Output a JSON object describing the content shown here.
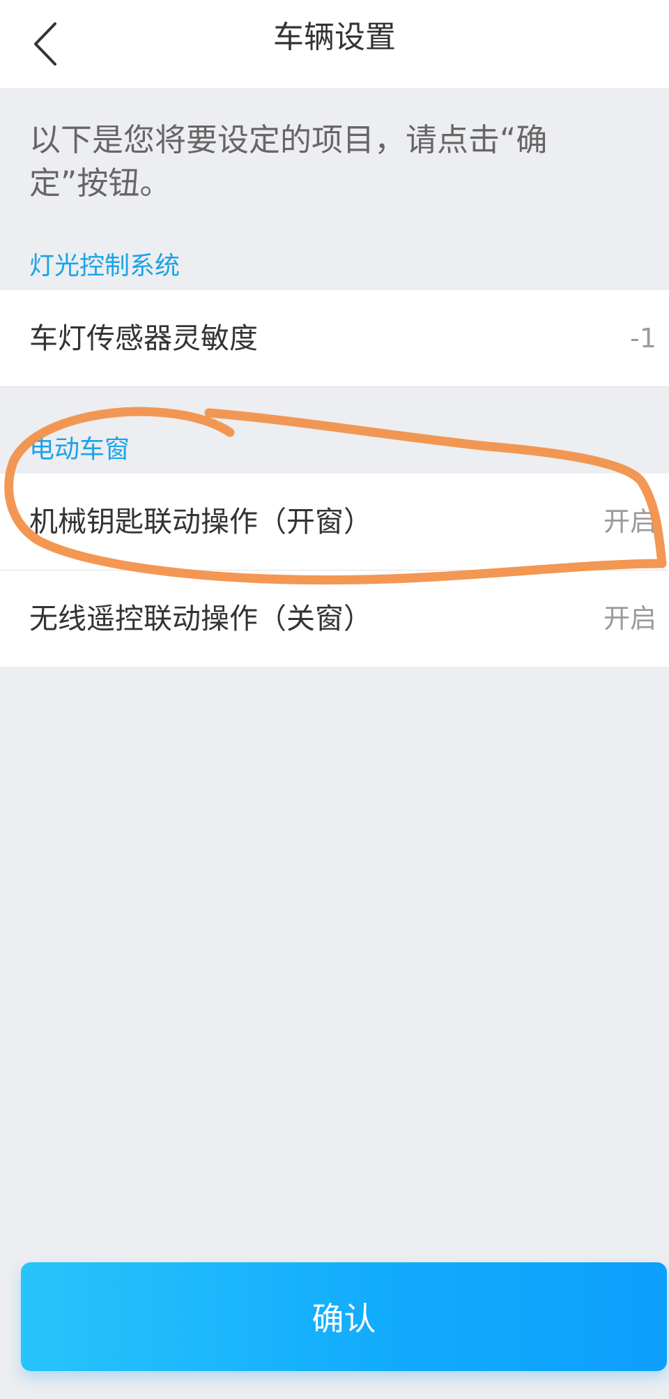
{
  "header": {
    "title": "车辆设置",
    "back_icon": "chevron-left-icon"
  },
  "intro_text": "以下是您将要设定的项目，请点击“确定”按钮。",
  "sections": [
    {
      "title": "灯光控制系统",
      "items": [
        {
          "label": "车灯传感器灵敏度",
          "value": "-1"
        }
      ]
    },
    {
      "title": "电动车窗",
      "items": [
        {
          "label": "机械钥匙联动操作（开窗）",
          "value": "开启"
        },
        {
          "label": "无线遥控联动操作（关窗）",
          "value": "开启"
        }
      ]
    }
  ],
  "confirm_label": "确认",
  "colors": {
    "accent": "#1aa3e8",
    "button_gradient_start": "#27c4fb",
    "button_gradient_end": "#0d9ffd",
    "annotation_stroke": "#f2914a",
    "background": "#eceef1"
  }
}
